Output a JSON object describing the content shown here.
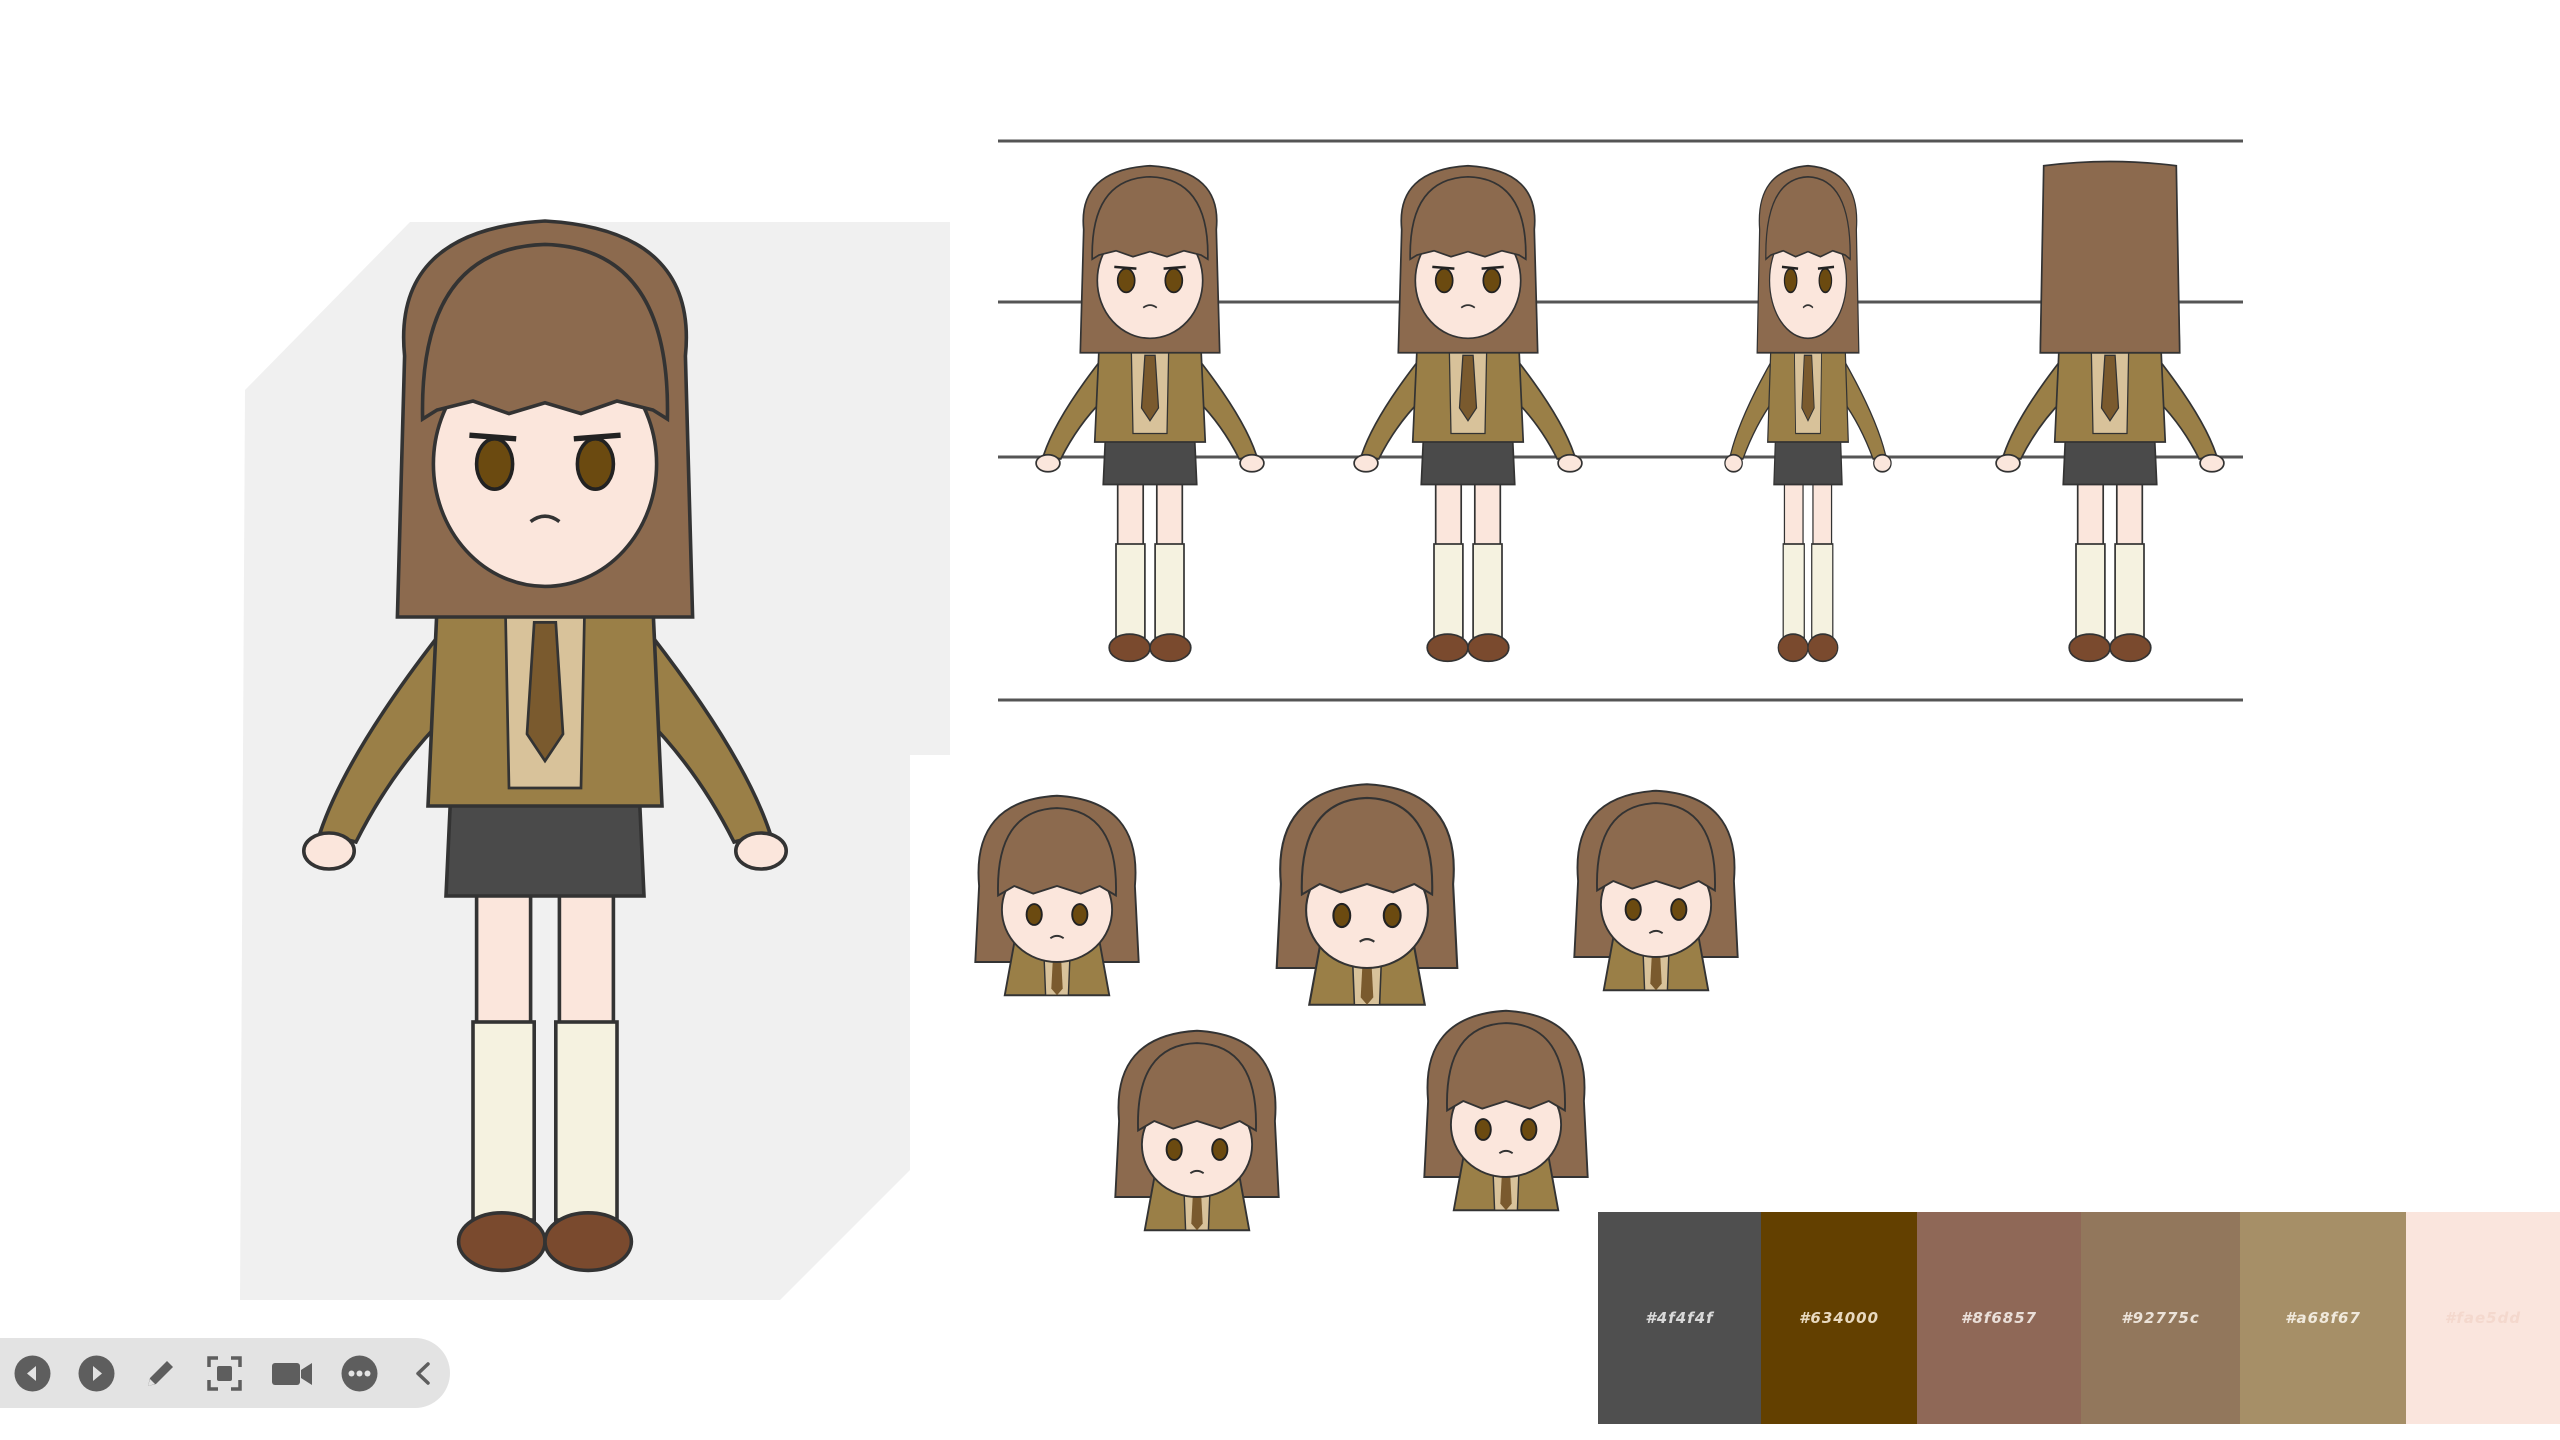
{
  "palette": {
    "swatches": [
      {
        "hex": "#4f4f4f",
        "label": "#4f4f4f",
        "text_color": "#d9d9d9"
      },
      {
        "hex": "#634000",
        "label": "#634000",
        "text_color": "#e8d9bf"
      },
      {
        "hex": "#8f6857",
        "label": "#8f6857",
        "text_color": "#eadfd9"
      },
      {
        "hex": "#92775c",
        "label": "#92775c",
        "text_color": "#ece3d9"
      },
      {
        "hex": "#a68f67",
        "label": "#a68f67",
        "text_color": "#f0e9dc"
      },
      {
        "hex": "#fae5dd",
        "label": "#fae5dd",
        "text_color": "#f4d8cd"
      }
    ]
  },
  "toolbar": {
    "buttons": [
      {
        "name": "previous-button",
        "icon": "previous-icon"
      },
      {
        "name": "next-button",
        "icon": "next-icon"
      },
      {
        "name": "pen-button",
        "icon": "pen-icon"
      },
      {
        "name": "screenshot-button",
        "icon": "screenshot-icon"
      },
      {
        "name": "camera-button",
        "icon": "video-camera-icon"
      },
      {
        "name": "more-button",
        "icon": "more-icon"
      },
      {
        "name": "collapse-button",
        "icon": "chevron-left-icon"
      }
    ]
  },
  "colors": {
    "hair": "#8c6a4e",
    "jacket": "#9a7f47",
    "shirt": "#d8c29a",
    "tie": "#7a5a2e",
    "shorts": "#4a4a4a",
    "skin": "#fbe6dc",
    "socks": "#f5f2e0",
    "shoes": "#7a4a2e",
    "panel_bg": "#f0f0f0",
    "guide_lines": "#555555"
  }
}
